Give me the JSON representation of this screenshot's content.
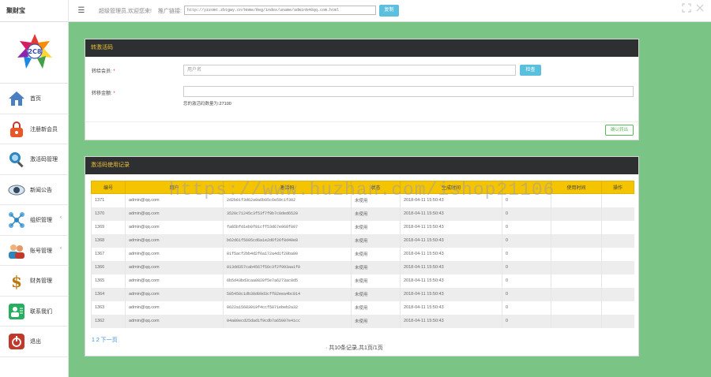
{
  "header": {
    "brand": "聚财宝",
    "welcome": "超级管理员,欢迎您来!",
    "promo_label": "推广链接:",
    "promo_url": "http://yzzomt.zbtgwy.cn/Home/Reg/index/uname/admin%40qq.com.html",
    "copy_label": "复制"
  },
  "sidebar": {
    "items": [
      {
        "label": "首页",
        "icon": "house-icon",
        "has_sub": false
      },
      {
        "label": "注册新会员",
        "icon": "lock-icon",
        "has_sub": false
      },
      {
        "label": "激活码管理",
        "icon": "search-icon",
        "has_sub": false
      },
      {
        "label": "新闻公告",
        "icon": "eye-icon",
        "has_sub": false
      },
      {
        "label": "组织管理",
        "icon": "network-icon",
        "has_sub": true
      },
      {
        "label": "账号管理",
        "icon": "users-icon",
        "has_sub": true
      },
      {
        "label": "财务管理",
        "icon": "dollar-icon",
        "has_sub": false
      },
      {
        "label": "联系我们",
        "icon": "contact-icon",
        "has_sub": false
      },
      {
        "label": "退出",
        "icon": "exit-icon",
        "has_sub": false
      }
    ]
  },
  "transfer": {
    "title": "转激活码",
    "account_label": "转给会员:",
    "account_placeholder": "用户名",
    "check_label": "检查",
    "amount_label": "转移金额:",
    "hint_prefix": "您的激活码数量为:",
    "hint_value": "27100",
    "confirm_label": "确认转出"
  },
  "records": {
    "title": "激活码使用记录",
    "columns": [
      "编号",
      "用户",
      "激活码",
      "状态",
      "生成时间",
      "",
      "使用时间",
      "操作"
    ],
    "rows": [
      [
        "1371",
        "admin@qq.com",
        "2d2b01f3d62a0a6b05c6e59c1f302",
        "未使用",
        "2018-04-11 15:50:43",
        "0",
        "",
        ""
      ],
      [
        "1370",
        "admin@qq.com",
        "3520c71245c3f53f7f8b7c8ded6520",
        "未使用",
        "2018-04-11 15:50:43",
        "0",
        "",
        ""
      ],
      [
        "1369",
        "admin@qq.com",
        "fa85bfd1eb0f81cff53d67e968f807",
        "未使用",
        "2018-04-11 15:50:43",
        "0",
        "",
        ""
      ],
      [
        "1368",
        "admin@qq.com",
        "b62d61f5605cd6a1e2d6f26f8d40e8",
        "未使用",
        "2018-04-11 15:50:43",
        "0",
        "",
        ""
      ],
      [
        "1367",
        "admin@qq.com",
        "81f5acf2bb4d2f6a172a4d1f20ba80",
        "未使用",
        "2018-04-11 15:50:43",
        "0",
        "",
        ""
      ],
      [
        "1366",
        "admin@qq.com",
        "813dd357cab4567f56c3f2f993aa1f0",
        "未使用",
        "2018-04-11 15:50:43",
        "0",
        "",
        ""
      ],
      [
        "1365",
        "admin@qq.com",
        "6b5d43bd3caa8828f5e7a6273ac8d5",
        "未使用",
        "2018-04-11 15:50:43",
        "0",
        "",
        ""
      ],
      [
        "1364",
        "admin@qq.com",
        "585450c1db38d09d3cff82eea4bc814",
        "未使用",
        "2018-04-11 15:50:43",
        "0",
        "",
        ""
      ],
      [
        "1363",
        "admin@qq.com",
        "0622a15683019f4ccf5871ebeb2a32",
        "未使用",
        "2018-04-11 15:50:43",
        "0",
        "",
        ""
      ],
      [
        "1362",
        "admin@qq.com",
        "04a80ecd25dad1f9cdb7a65007e41cc",
        "未使用",
        "2018-04-11 15:50:43",
        "0",
        "",
        ""
      ]
    ],
    "pager_next": "1 2 下一页",
    "pager_info": "· 共10条记录,共1页/1页"
  },
  "watermark": "https://www.huzhan.com/ishop21106",
  "colors": {
    "background": "#7ac485",
    "panel_header": "#2d2f30",
    "panel_header_text": "#f0c33c",
    "table_header": "#f5c400",
    "accent_button": "#5bc0de",
    "confirm_button": "#5cb85c"
  }
}
